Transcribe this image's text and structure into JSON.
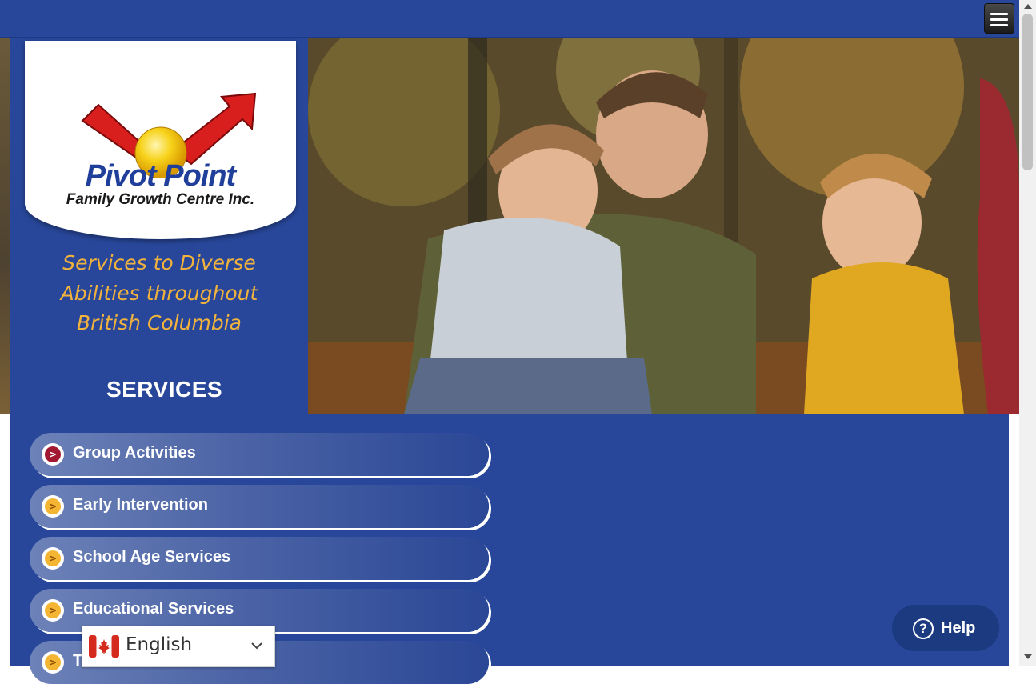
{
  "header": {
    "menu_icon": "hamburger-menu-icon"
  },
  "logo": {
    "name": "Pivot Point",
    "subtitle": "Family Growth Centre Inc."
  },
  "tagline": {
    "line1": "Services to Diverse",
    "line2": "Abilities throughout",
    "line3": "British Columbia"
  },
  "services": {
    "title": "SERVICES",
    "items": [
      {
        "label": "Group Activities",
        "icon_color": "red"
      },
      {
        "label": "Early Intervention",
        "icon_color": "yellow"
      },
      {
        "label": "School Age Services",
        "icon_color": "yellow"
      },
      {
        "label": "Educational Services",
        "icon_color": "yellow"
      },
      {
        "label": "T",
        "icon_color": "yellow"
      }
    ]
  },
  "language": {
    "selected": "English",
    "flag": "canada-flag-icon"
  },
  "help": {
    "label": "Help",
    "icon": "question-mark-icon"
  },
  "colors": {
    "brand_blue": "#28479a",
    "accent_yellow": "#f2b33d",
    "help_blue": "#1b3a80"
  }
}
